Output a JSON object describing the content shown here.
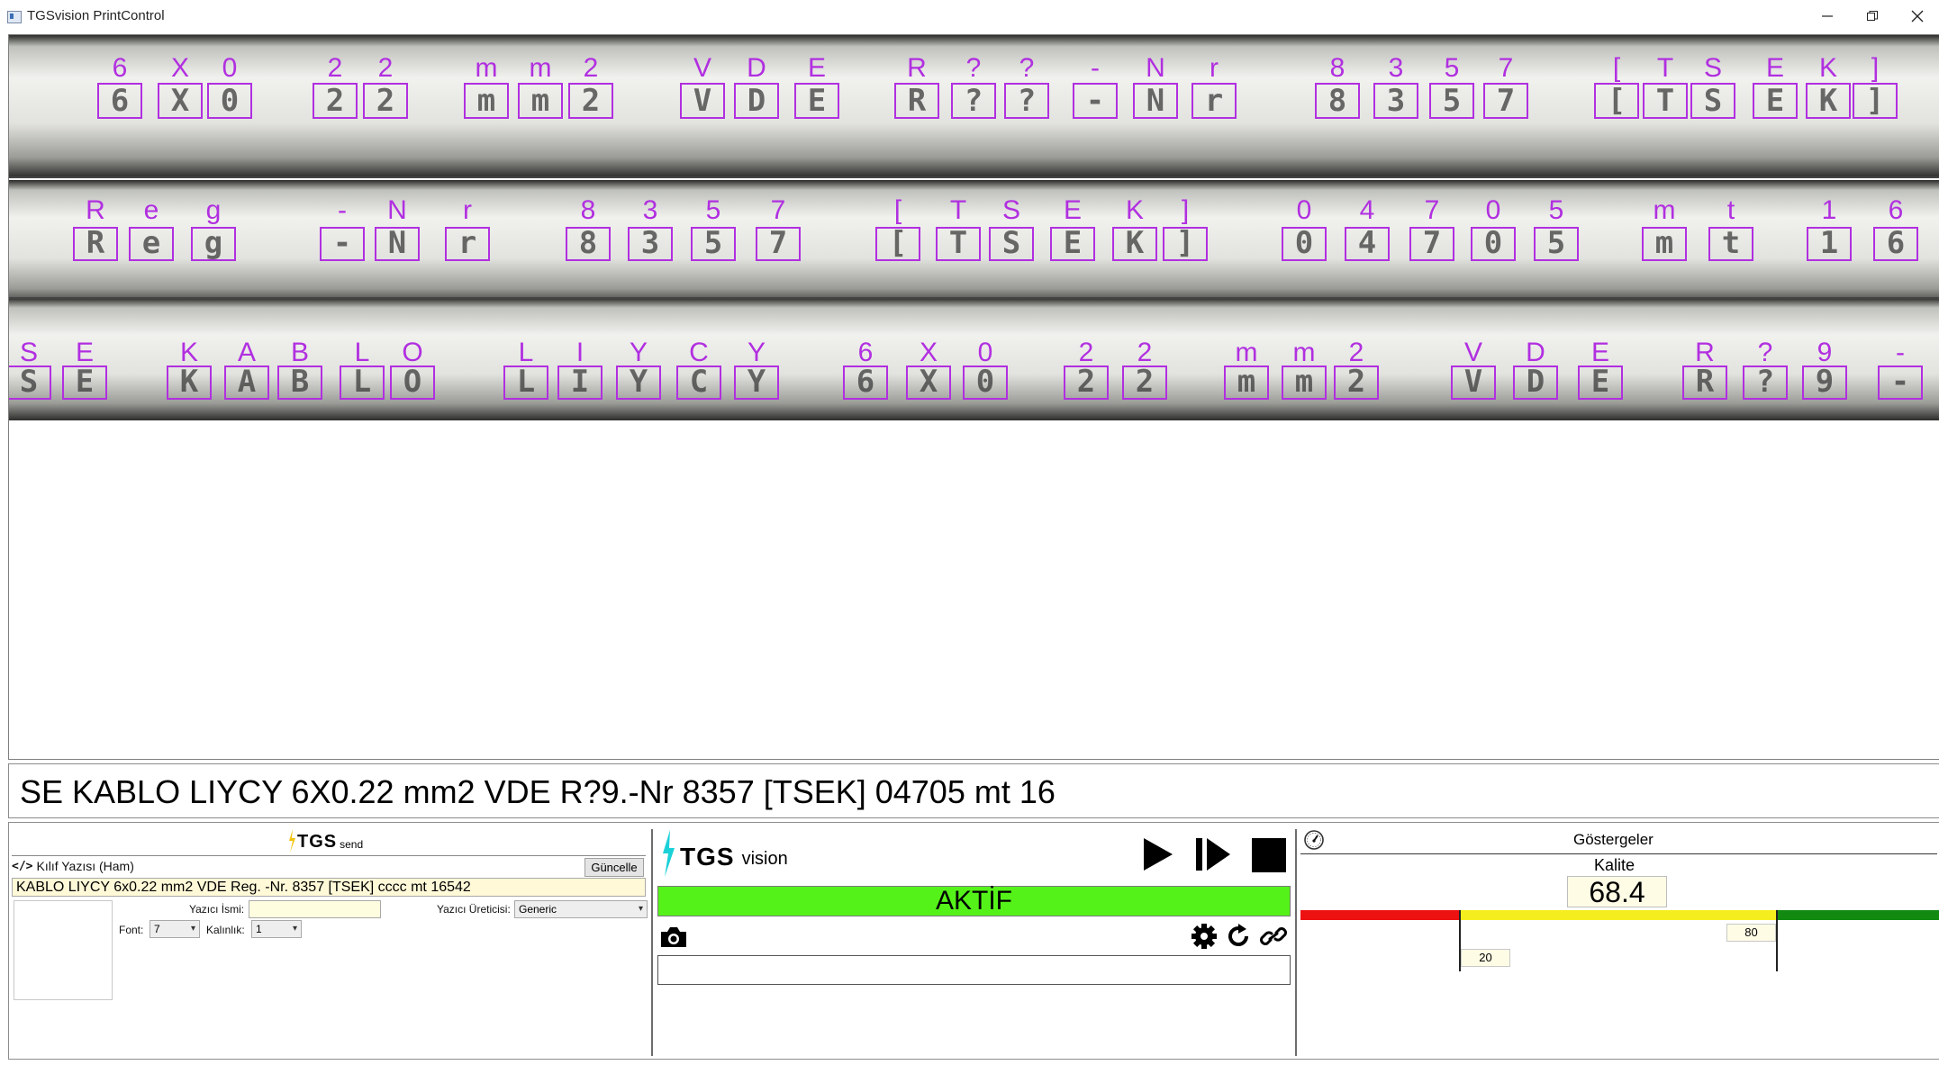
{
  "window": {
    "title": "TGSvision PrintControl",
    "controls": [
      "minimize",
      "restore",
      "close"
    ]
  },
  "camera": {
    "rows": [
      {
        "labels": [
          {
            "ch": "6",
            "box": true
          },
          {
            "ch": "X",
            "box": true
          },
          {
            "ch": "0",
            "box": true
          },
          {
            "ch": "2",
            "box": true
          },
          {
            "ch": "2",
            "box": true
          },
          {
            "ch": "m",
            "box": true
          },
          {
            "ch": "m",
            "box": true
          },
          {
            "ch": "2",
            "box": true
          },
          {
            "ch": "V",
            "box": true
          },
          {
            "ch": "D",
            "box": true
          },
          {
            "ch": "E",
            "box": true
          },
          {
            "ch": "R",
            "box": true
          },
          {
            "ch": "?",
            "box": true
          },
          {
            "ch": "?",
            "box": true
          },
          {
            "ch": "-",
            "box": true
          },
          {
            "ch": "N",
            "box": true
          },
          {
            "ch": "r",
            "box": true
          },
          {
            "ch": "8",
            "box": true
          },
          {
            "ch": "3",
            "box": true
          },
          {
            "ch": "5",
            "box": true
          },
          {
            "ch": "7",
            "box": true
          },
          {
            "ch": "[",
            "box": true
          },
          {
            "ch": "T",
            "box": true
          },
          {
            "ch": "S",
            "box": true
          },
          {
            "ch": "E",
            "box": true
          },
          {
            "ch": "K",
            "box": true
          },
          {
            "ch": "]",
            "box": true
          }
        ]
      },
      {
        "labels": [
          {
            "ch": "R",
            "box": true
          },
          {
            "ch": "e",
            "box": true
          },
          {
            "ch": "g",
            "box": true
          },
          {
            "ch": "-",
            "box": true
          },
          {
            "ch": "N",
            "box": true
          },
          {
            "ch": "r",
            "box": true
          },
          {
            "ch": "8",
            "box": true
          },
          {
            "ch": "3",
            "box": true
          },
          {
            "ch": "5",
            "box": true
          },
          {
            "ch": "7",
            "box": true
          },
          {
            "ch": "[",
            "box": true
          },
          {
            "ch": "T",
            "box": true
          },
          {
            "ch": "S",
            "box": true
          },
          {
            "ch": "E",
            "box": true
          },
          {
            "ch": "K",
            "box": true
          },
          {
            "ch": "]",
            "box": true
          },
          {
            "ch": "0",
            "box": true
          },
          {
            "ch": "4",
            "box": true
          },
          {
            "ch": "7",
            "box": true
          },
          {
            "ch": "0",
            "box": true
          },
          {
            "ch": "5",
            "box": true
          },
          {
            "ch": "m",
            "box": true
          },
          {
            "ch": "t",
            "box": true
          },
          {
            "ch": "1",
            "box": true
          },
          {
            "ch": "6",
            "box": true
          }
        ]
      },
      {
        "labels": [
          {
            "ch": "S",
            "box": true
          },
          {
            "ch": "E",
            "box": true
          },
          {
            "ch": "K",
            "box": true
          },
          {
            "ch": "A",
            "box": true
          },
          {
            "ch": "B",
            "box": true
          },
          {
            "ch": "L",
            "box": true
          },
          {
            "ch": "O",
            "box": true
          },
          {
            "ch": "L",
            "box": true
          },
          {
            "ch": "I",
            "box": true
          },
          {
            "ch": "Y",
            "box": true
          },
          {
            "ch": "C",
            "box": true
          },
          {
            "ch": "Y",
            "box": true
          },
          {
            "ch": "6",
            "box": true
          },
          {
            "ch": "X",
            "box": true
          },
          {
            "ch": "0",
            "box": true
          },
          {
            "ch": "2",
            "box": true
          },
          {
            "ch": "2",
            "box": true
          },
          {
            "ch": "m",
            "box": true
          },
          {
            "ch": "m",
            "box": true
          },
          {
            "ch": "2",
            "box": true
          },
          {
            "ch": "V",
            "box": true
          },
          {
            "ch": "D",
            "box": true
          },
          {
            "ch": "E",
            "box": true
          },
          {
            "ch": "R",
            "box": true
          },
          {
            "ch": "?",
            "box": true
          },
          {
            "ch": "9",
            "box": true
          },
          {
            "ch": "-",
            "box": true
          }
        ]
      }
    ],
    "box_color": "#b12fe0",
    "label_color": "#b12fe0"
  },
  "ocr_output": "SE KABLO LIYCY 6X0.22 mm2 VDE R?9.-Nr 8357 [TSEK] 04705 mt 16",
  "send_panel": {
    "logo": {
      "brand": "TGS",
      "suffix": "send"
    },
    "section_label": "Kılıf Yazısı (Ham)",
    "update_button": "Güncelle",
    "raw_text": "KABLO LIYCY 6x0.22 mm2 VDE Reg. -Nr. 8357 [TSEK] cccc mt 16542",
    "printer_name_label": "Yazıcı İsmi:",
    "printer_name_value": "",
    "printer_maker_label": "Yazıcı Üreticisi:",
    "printer_maker_value": "Generic",
    "font_label": "Font:",
    "font_value": "7",
    "thickness_label": "Kalınlık:",
    "thickness_value": "1"
  },
  "vision_panel": {
    "logo": {
      "brand": "TGS",
      "suffix": "vision"
    },
    "status": "AKTİF",
    "status_color": "#55f21a",
    "controls": [
      "play-icon",
      "step-icon",
      "stop-icon"
    ],
    "tools": [
      "camera-icon",
      "gear-icon",
      "refresh-icon",
      "link-icon"
    ],
    "message": ""
  },
  "gauge_panel": {
    "title": "Göstergeler",
    "metric_label": "Kalite",
    "value": "68.4",
    "low_threshold": "20",
    "high_threshold": "80",
    "zone_colors": {
      "low": "#ee1111",
      "mid": "#f5ee1e",
      "high": "#128a12"
    }
  }
}
